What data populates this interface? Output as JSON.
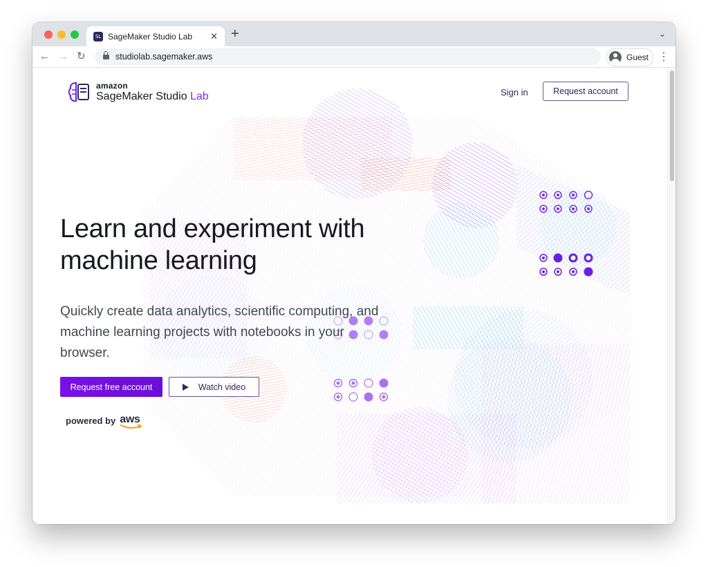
{
  "browser": {
    "tab_title": "SageMaker Studio Lab",
    "favicon_text": "SL",
    "new_tab": "+",
    "url": "studiolab.sagemaker.aws",
    "profile_label": "Guest",
    "icons": [
      "back-arrow-icon",
      "forward-arrow-icon",
      "reload-icon",
      "lock-icon",
      "guest-avatar-icon",
      "kebab-menu-icon",
      "tab-close-icon",
      "chevron-down-icon"
    ]
  },
  "header": {
    "brand_small": "amazon",
    "brand_product": "SageMaker Studio",
    "brand_suffix": "Lab",
    "sign_in": "Sign in",
    "request_account": "Request account"
  },
  "hero": {
    "headline_line1": "Learn and experiment with",
    "headline_line2": "machine learning",
    "sub_line1": "Quickly create data analytics, scientific computing, and",
    "sub_line2": "machine learning projects with notebooks in your",
    "sub_line3": "browser.",
    "primary_cta": "Request free account",
    "secondary_cta": "Watch video",
    "powered_by": "powered by",
    "aws": "aws"
  },
  "colors": {
    "accent": "#7a0fe6",
    "brand_dark": "#2b2a5e",
    "lab_purple": "#8a2be2",
    "dot_purple": "#7a2fe0"
  }
}
